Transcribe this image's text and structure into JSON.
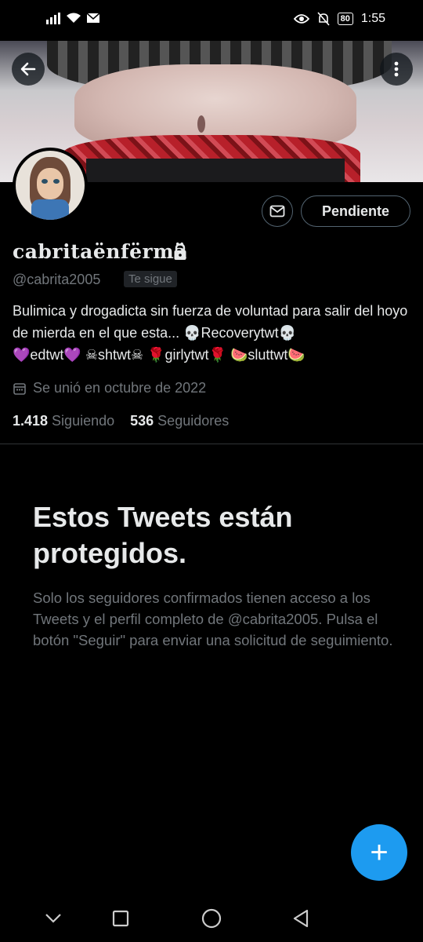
{
  "status_bar": {
    "time": "1:55",
    "battery": "80",
    "icons": [
      "signal-icon",
      "wifi-icon",
      "mail-notification-icon",
      "eye-icon",
      "mute-icon",
      "battery-icon"
    ]
  },
  "header": {
    "back_icon": "arrow-left-icon",
    "more_icon": "more-vertical-icon"
  },
  "profile": {
    "display_name": "cabritaënfërmä",
    "handle": "@cabrita2005",
    "follows_you": "Te sigue",
    "bio_line1": "Bulimica y drogadicta sin fuerza de voluntad para salir del hoyo de mierda en el que esta... 💀Recoverytwt💀",
    "bio_line2": "💜edtwt💜 ☠shtwt☠ 🌹girlytwt🌹 🍉sluttwt🍉",
    "joined": "Se unió en octubre de 2022",
    "following_count": "1.418",
    "following_label": "Siguiendo",
    "followers_count": "536",
    "followers_label": "Seguidores"
  },
  "actions": {
    "message_icon": "mail-icon",
    "pending_label": "Pendiente"
  },
  "protected": {
    "title": "Estos Tweets están protegidos.",
    "body": "Solo los seguidores confirmados tienen acceso a los Tweets y el perfil completo de @cabrita2005. Pulsa el botón \"Seguir\" para enviar una solicitud de seguimiento."
  },
  "fab": {
    "label": "+"
  },
  "colors": {
    "background": "#000000",
    "primary_text": "#e7e9ea",
    "secondary_text": "#71767b",
    "accent": "#1d9bf0",
    "border": "#536471"
  }
}
